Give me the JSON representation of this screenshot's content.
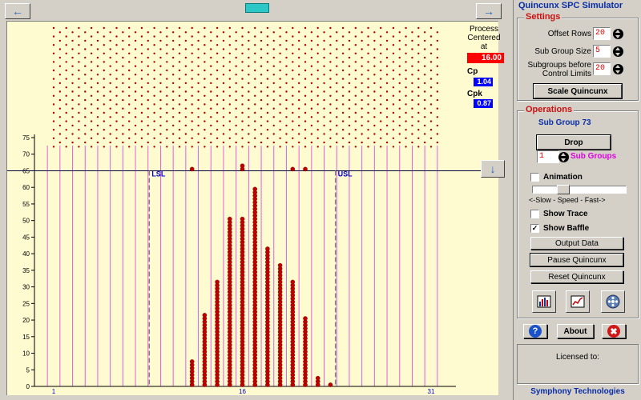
{
  "app": {
    "title": "Quincunx SPC Simulator",
    "footer": "Symphony Technologies"
  },
  "process": {
    "centered_label_1": "Process",
    "centered_label_2": "Centered",
    "centered_label_3": "at",
    "centered_value": "16.00",
    "cp_label": "Cp",
    "cp_value": "1.04",
    "cpk_label": "Cpk",
    "cpk_value": "0.87"
  },
  "settings": {
    "group_label": "Settings",
    "offset_rows_label": "Offset Rows",
    "offset_rows_value": "20",
    "sub_group_size_label": "Sub Group Size",
    "sub_group_size_value": "5",
    "subgroups_before_label_1": "Subgroups before",
    "subgroups_before_label_2": "Control Limits",
    "subgroups_before_value": "20",
    "scale_button": "Scale Quincunx"
  },
  "operations": {
    "group_label": "Operations",
    "sub_group_status": "Sub Group 73",
    "drop_button": "Drop",
    "drop_count": "1",
    "sub_groups_label": "Sub Groups",
    "animation_label": "Animation",
    "speed_label": "<-Slow - Speed - Fast->",
    "show_trace_label": "Show Trace",
    "show_baffle_label": "Show Baffle",
    "output_button": "Output Data",
    "pause_button": "Pause Quincunx",
    "reset_button": "Reset Quincunx",
    "about_button": "About",
    "licensed_label": "Licensed to:"
  },
  "checks": {
    "animation": false,
    "show_trace": false,
    "show_baffle": true
  },
  "colors": {
    "canvas": "#fffbd1",
    "pin": "#b00000",
    "bin_line": "#e060e0",
    "spec_line": "#808080",
    "ball": "#c00000",
    "value_box": "#ff0000",
    "stat_box": "#0000ff"
  },
  "chart_data": {
    "type": "bar",
    "bins": [
      1,
      2,
      3,
      4,
      5,
      6,
      7,
      8,
      9,
      10,
      11,
      12,
      13,
      14,
      15,
      16,
      17,
      18,
      19,
      20,
      21,
      22,
      23,
      24,
      25,
      26,
      27,
      28,
      29,
      30,
      31
    ],
    "x_tick_labels": [
      "1",
      "16",
      "31"
    ],
    "values": [
      0,
      0,
      0,
      0,
      0,
      0,
      0,
      0,
      0,
      0,
      0,
      8,
      22,
      32,
      51,
      51,
      60,
      42,
      37,
      32,
      21,
      3,
      1,
      0,
      0,
      0,
      0,
      0,
      0,
      0,
      0
    ],
    "ylim": [
      0,
      75
    ],
    "y_ticks": [
      0,
      5,
      10,
      15,
      20,
      25,
      30,
      35,
      40,
      45,
      50,
      55,
      60,
      65,
      70,
      75
    ],
    "lsl_label": "LSL",
    "lsl_bin": 8.6,
    "usl_label": "USL",
    "usl_bin": 23.4,
    "control_line_value": 65,
    "scatter_above_line": [
      {
        "bin": 12,
        "y": 65.5
      },
      {
        "bin": 16,
        "y": 65.5
      },
      {
        "bin": 16,
        "y": 66.5
      },
      {
        "bin": 20,
        "y": 65.5
      },
      {
        "bin": 21,
        "y": 65.5
      }
    ]
  }
}
